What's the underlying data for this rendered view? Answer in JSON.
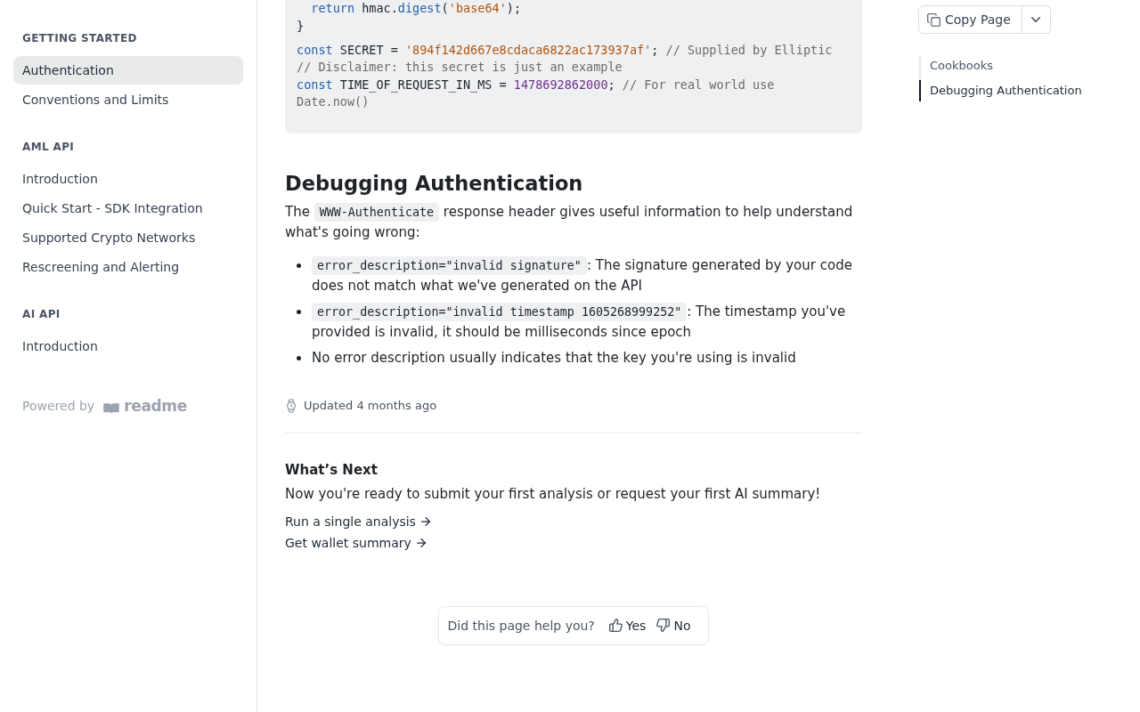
{
  "sidebar": {
    "sections": [
      {
        "title": "GETTING STARTED",
        "items": [
          {
            "label": "Authentication",
            "selected": true
          },
          {
            "label": "Conventions and Limits",
            "selected": false
          }
        ]
      },
      {
        "title": "AML API",
        "items": [
          {
            "label": "Introduction",
            "selected": false
          },
          {
            "label": "Quick Start - SDK Integration",
            "selected": false
          },
          {
            "label": "Supported Crypto Networks",
            "selected": false
          },
          {
            "label": "Rescreening and Alerting",
            "selected": false
          }
        ]
      },
      {
        "title": "AI API",
        "items": [
          {
            "label": "Introduction",
            "selected": false
          }
        ]
      }
    ],
    "powered_by": "Powered by",
    "logo_text": "readme"
  },
  "code_block": {
    "lines": [
      {
        "kind": "code",
        "tokens": [
          {
            "kind": "keyword",
            "text": "  return"
          },
          {
            "kind": "plain",
            "text": " hmac."
          },
          {
            "kind": "function",
            "text": "digest"
          },
          {
            "kind": "plain",
            "text": "("
          },
          {
            "kind": "string",
            "text": "'base64'"
          },
          {
            "kind": "plain",
            "text": ");"
          }
        ]
      },
      {
        "kind": "code",
        "tokens": [
          {
            "kind": "plain",
            "text": "}"
          }
        ]
      },
      {
        "kind": "blank"
      },
      {
        "kind": "code",
        "tokens": [
          {
            "kind": "keyword",
            "text": "const"
          },
          {
            "kind": "plain",
            "text": " SECRET = "
          },
          {
            "kind": "string",
            "text": "'894f142d667e8cdaca6822ac173937af'"
          },
          {
            "kind": "plain",
            "text": "; "
          },
          {
            "kind": "comment",
            "text": "// Supplied by Elliptic"
          }
        ]
      },
      {
        "kind": "code",
        "tokens": [
          {
            "kind": "comment",
            "text": "// Disclaimer: this secret is just an example"
          }
        ]
      },
      {
        "kind": "code",
        "tokens": [
          {
            "kind": "keyword",
            "text": "const"
          },
          {
            "kind": "plain",
            "text": " TIME_OF_REQUEST_IN_MS = "
          },
          {
            "kind": "number",
            "text": "1478692862000"
          },
          {
            "kind": "plain",
            "text": "; "
          },
          {
            "kind": "comment",
            "text": "// For real world use Date.now()"
          }
        ]
      }
    ]
  },
  "article": {
    "heading": "Debugging Authentication",
    "intro": [
      {
        "kind": "text",
        "text": "The "
      },
      {
        "kind": "code",
        "text": "WWW-Authenticate"
      },
      {
        "kind": "text",
        "text": " response header gives useful information to help understand what's going wrong:"
      }
    ],
    "bullets": [
      [
        {
          "kind": "code",
          "text": "error_description=\"invalid signature\""
        },
        {
          "kind": "text",
          "text": ": The signature generated by your code does not match what we've generated on the API"
        }
      ],
      [
        {
          "kind": "code",
          "text": "error_description=\"invalid timestamp 1605268999252\""
        },
        {
          "kind": "text",
          "text": ": The timestamp you've provided is invalid, it should be milliseconds since epoch"
        }
      ],
      [
        {
          "kind": "text",
          "text": "No error description usually indicates that the key you're using is invalid"
        }
      ]
    ],
    "updated": "Updated 4 months ago"
  },
  "whats_next": {
    "title": "What’s Next",
    "description": "Now you're ready to submit your first analysis or request your first AI summary!",
    "links": [
      "Run a single analysis",
      "Get wallet summary"
    ]
  },
  "feedback": {
    "question": "Did this page help you?",
    "buttons": [
      {
        "kind": "yes",
        "label": "Yes"
      },
      {
        "kind": "no",
        "label": "No"
      }
    ]
  },
  "page_actions": {
    "copy_label": "Copy Page"
  },
  "toc": {
    "items": [
      {
        "label": "Cookbooks",
        "selected": false
      },
      {
        "label": "Debugging Authentication",
        "selected": true
      }
    ]
  }
}
